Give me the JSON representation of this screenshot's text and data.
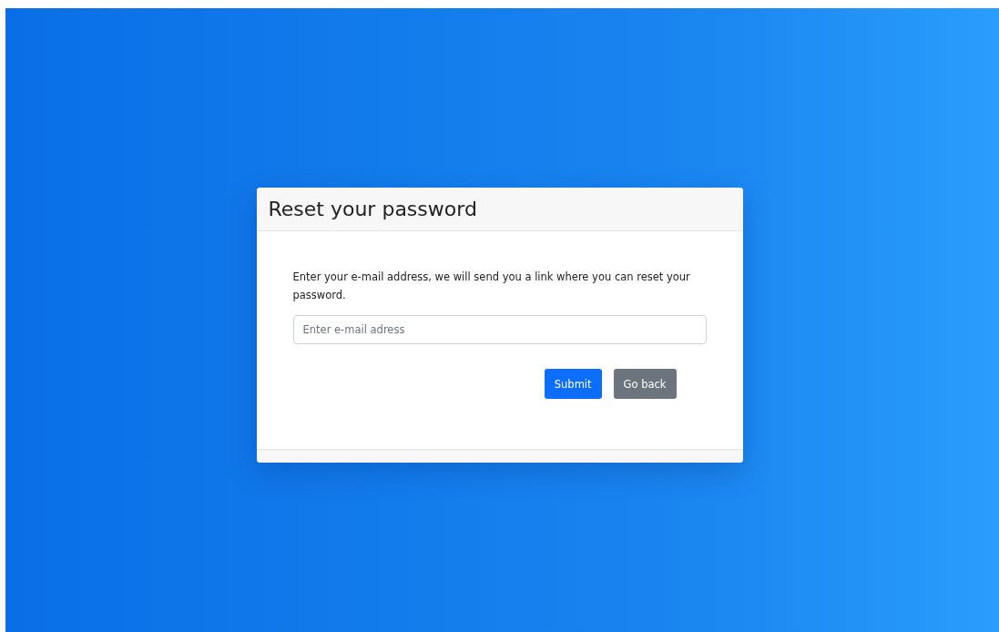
{
  "card": {
    "title": "Reset your password",
    "description": "Enter your e-mail address, we will send you a link where you can reset your password.",
    "email_field": {
      "placeholder": "Enter e-mail adress"
    },
    "buttons": [
      {
        "label": "Submit",
        "kind": "primary"
      },
      {
        "label": "Go back",
        "kind": "secondary"
      }
    ]
  }
}
